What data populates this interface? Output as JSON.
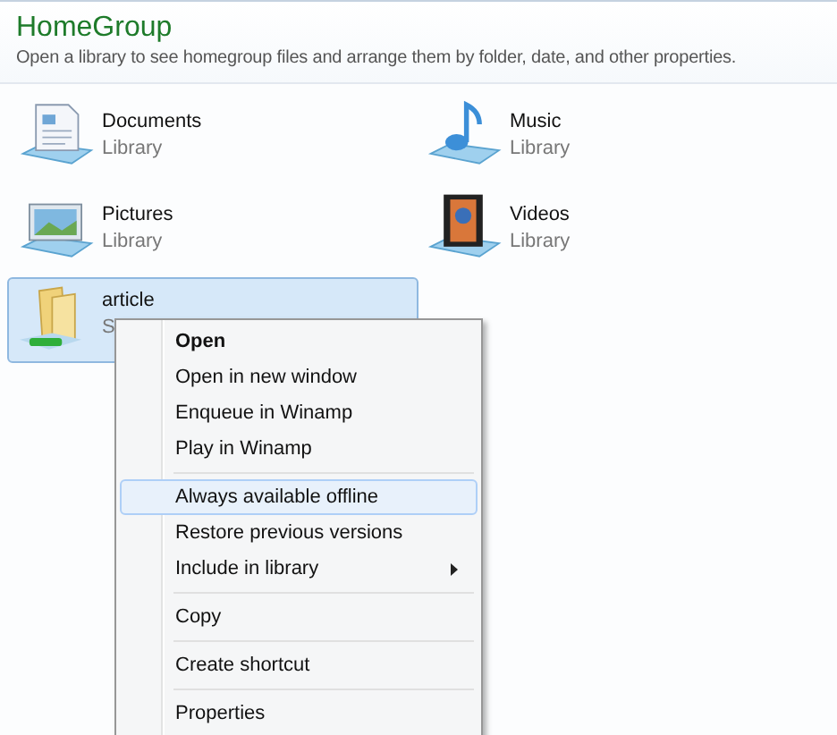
{
  "header": {
    "title": "HomeGroup",
    "subtitle": "Open a library to see homegroup files and arrange them by folder, date, and other properties."
  },
  "libraries": [
    {
      "kind": "documents",
      "name": "Documents",
      "type": "Library",
      "selected": false
    },
    {
      "kind": "music",
      "name": "Music",
      "type": "Library",
      "selected": false
    },
    {
      "kind": "pictures",
      "name": "Pictures",
      "type": "Library",
      "selected": false
    },
    {
      "kind": "videos",
      "name": "Videos",
      "type": "Library",
      "selected": false
    },
    {
      "kind": "folder",
      "name": "article",
      "type": "S",
      "selected": true
    }
  ],
  "context_menu": {
    "items": [
      {
        "kind": "item",
        "label": "Open",
        "bold": true,
        "selected": false,
        "submenu": false
      },
      {
        "kind": "item",
        "label": "Open in new window",
        "bold": false,
        "selected": false,
        "submenu": false
      },
      {
        "kind": "item",
        "label": "Enqueue in Winamp",
        "bold": false,
        "selected": false,
        "submenu": false
      },
      {
        "kind": "item",
        "label": "Play in Winamp",
        "bold": false,
        "selected": false,
        "submenu": false
      },
      {
        "kind": "separator"
      },
      {
        "kind": "item",
        "label": "Always available offline",
        "bold": false,
        "selected": true,
        "submenu": false
      },
      {
        "kind": "item",
        "label": "Restore previous versions",
        "bold": false,
        "selected": false,
        "submenu": false
      },
      {
        "kind": "item",
        "label": "Include in library",
        "bold": false,
        "selected": false,
        "submenu": true
      },
      {
        "kind": "separator"
      },
      {
        "kind": "item",
        "label": "Copy",
        "bold": false,
        "selected": false,
        "submenu": false
      },
      {
        "kind": "separator"
      },
      {
        "kind": "item",
        "label": "Create shortcut",
        "bold": false,
        "selected": false,
        "submenu": false
      },
      {
        "kind": "separator"
      },
      {
        "kind": "item",
        "label": "Properties",
        "bold": false,
        "selected": false,
        "submenu": false
      }
    ]
  }
}
